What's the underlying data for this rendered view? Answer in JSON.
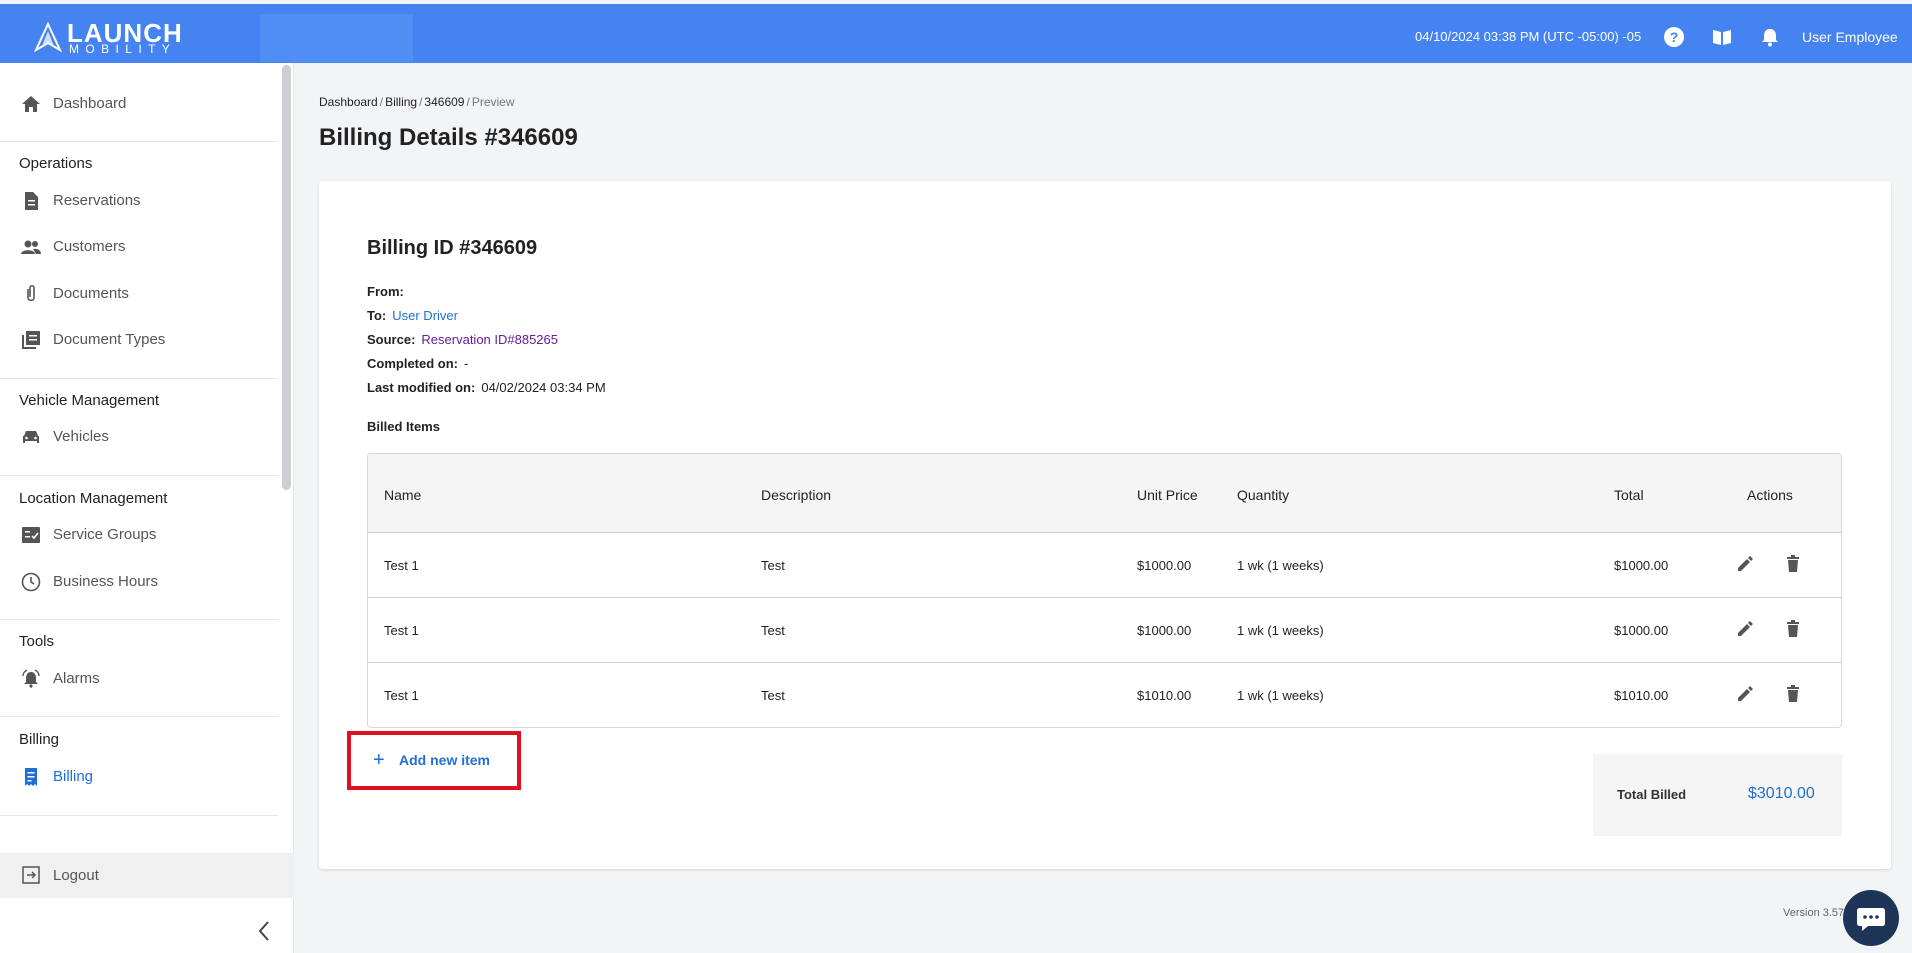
{
  "app": {
    "logo_word": "LAUNCH",
    "logo_sub": "MOBILITY"
  },
  "topbar": {
    "datetime": "04/10/2024 03:38 PM (UTC -05:00) -05",
    "user": "User Employee",
    "icons": [
      "help-icon",
      "book-icon",
      "bell-icon"
    ]
  },
  "sidebar": {
    "dashboard": "Dashboard",
    "sections": {
      "operations": "Operations",
      "vehicle_management": "Vehicle Management",
      "location_management": "Location Management",
      "tools": "Tools",
      "billing": "Billing"
    },
    "items": {
      "reservations": "Reservations",
      "customers": "Customers",
      "documents": "Documents",
      "document_types": "Document Types",
      "vehicles": "Vehicles",
      "service_groups": "Service Groups",
      "business_hours": "Business Hours",
      "alarms": "Alarms",
      "billing": "Billing"
    },
    "logout": "Logout"
  },
  "breadcrumb": {
    "b1": "Dashboard",
    "b2": "Billing",
    "b3": "346609",
    "current": "Preview",
    "sep": "/"
  },
  "page_title": "Billing Details #346609",
  "details": {
    "billing_id": "Billing ID #346609",
    "from_label": "From:",
    "from_value": "",
    "to_label": "To:",
    "to_value": "User Driver",
    "source_label": "Source:",
    "source_value": "Reservation ID#885265",
    "completed_label": "Completed on:",
    "completed_value": "-",
    "modified_label": "Last modified on:",
    "modified_value": "04/02/2024 03:34 PM",
    "billed_items": "Billed Items"
  },
  "table": {
    "headers": {
      "name": "Name",
      "description": "Description",
      "unit_price": "Unit Price",
      "quantity": "Quantity",
      "total": "Total",
      "actions": "Actions"
    },
    "rows": [
      {
        "name": "Test 1",
        "description": "Test",
        "unit_price": "$1000.00",
        "quantity": "1 wk (1 weeks)",
        "total": "$1000.00"
      },
      {
        "name": "Test 1",
        "description": "Test",
        "unit_price": "$1000.00",
        "quantity": "1 wk (1 weeks)",
        "total": "$1000.00"
      },
      {
        "name": "Test 1",
        "description": "Test",
        "unit_price": "$1010.00",
        "quantity": "1 wk (1 weeks)",
        "total": "$1010.00"
      }
    ]
  },
  "add_item": {
    "plus": "+",
    "label": "Add new item"
  },
  "summary": {
    "label": "Total Billed",
    "value": "$3010.00"
  },
  "footer": {
    "version": "Version 3.57"
  },
  "colors": {
    "topbar": "#4583f0",
    "link": "#1f6fd6",
    "source_link": "#6a1b9a",
    "highlight": "#e0101e",
    "chat": "#1d3557"
  }
}
